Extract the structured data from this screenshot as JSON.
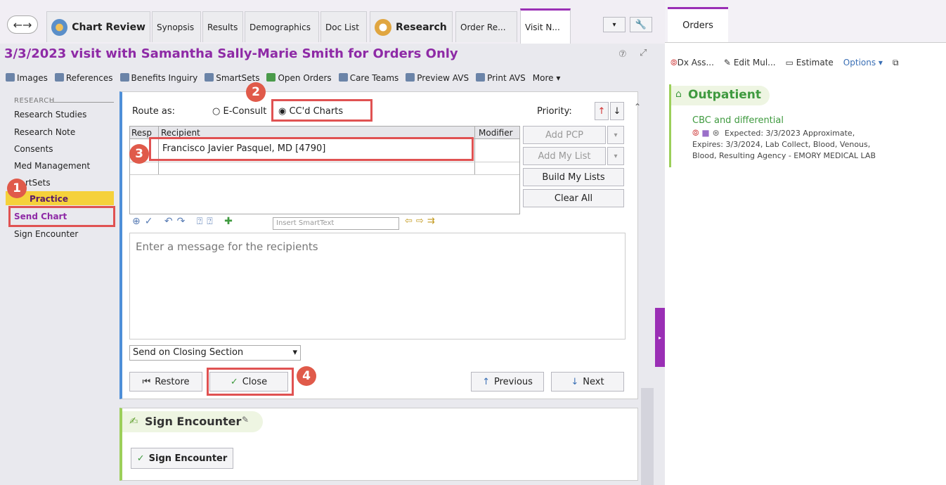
{
  "tabs": {
    "chart_review": "Chart Review",
    "synopsis": "Synopsis",
    "results": "Results",
    "demographics": "Demographics",
    "doc_list": "Doc List",
    "research": "Research",
    "order_re": "Order Re...",
    "visit_n": "Visit N..."
  },
  "header": {
    "title": "3/3/2023 visit with Samantha Sally-Marie Smith for Orders Only"
  },
  "toolbar": {
    "images": "Images",
    "references": "References",
    "benefits": "Benefits Inguiry",
    "smartsets": "SmartSets",
    "open_orders": "Open Orders",
    "care_teams": "Care Teams",
    "preview_avs": "Preview AVS",
    "print_avs": "Print AVS",
    "more": "More"
  },
  "sidebar": {
    "section": "RESEARCH",
    "items": [
      "Research Studies",
      "Research Note",
      "Consents",
      "Med Management",
      "rtSets",
      "Practice",
      "Send Chart",
      "Sign Encounter"
    ]
  },
  "form": {
    "route_as": "Route as:",
    "e_consult": "E-Consult",
    "ccd_charts": "CC'd Charts",
    "priority": "Priority:",
    "col_resp": "Resp",
    "col_recipient": "Recipient",
    "col_modifier": "Modifier",
    "recipient": "Francisco Javier Pasquel, MD [4790]",
    "add_pcp": "Add PCP",
    "add_my_list": "Add My List",
    "build_my_lists": "Build My Lists",
    "clear_all": "Clear All",
    "insert_smarttext": "Insert SmartText",
    "message_placeholder": "Enter a message for the recipients",
    "send_on": "Send on Closing Section",
    "restore": "Restore",
    "close": "Close",
    "previous": "Previous",
    "next": "Next"
  },
  "sign": {
    "title": "Sign Encounter",
    "button": "Sign Encounter"
  },
  "callouts": [
    "1",
    "2",
    "3",
    "4"
  ],
  "orders": {
    "tab": "Orders",
    "dx": "Dx Ass...",
    "edit": "Edit Mul...",
    "estimate": "Estimate",
    "options": "Options",
    "outpatient": "Outpatient",
    "order_name": "CBC and differential",
    "detail1": "Expected: 3/3/2023 Approximate,",
    "detail2": "Expires: 3/3/2024, Lab Collect, Blood, Venous,",
    "detail3": "Blood, Resulting Agency - EMORY MEDICAL LAB"
  },
  "colors": {
    "accent": "#8e2aa6",
    "callout": "#e05a4a",
    "green": "#3f9a3f"
  }
}
